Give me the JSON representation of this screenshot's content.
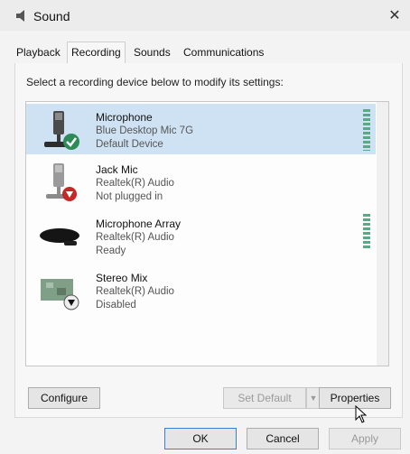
{
  "window": {
    "title": "Sound"
  },
  "tabs": [
    {
      "label": "Playback",
      "active": false
    },
    {
      "label": "Recording",
      "active": true
    },
    {
      "label": "Sounds",
      "active": false
    },
    {
      "label": "Communications",
      "active": false
    }
  ],
  "instruction": "Select a recording device below to modify its settings:",
  "devices": [
    {
      "name": "Microphone",
      "driver": "Blue Desktop Mic 7G",
      "status": "Default Device",
      "selected": true,
      "badge": "default-check"
    },
    {
      "name": "Jack Mic",
      "driver": "Realtek(R) Audio",
      "status": "Not plugged in",
      "selected": false,
      "badge": "unplugged-arrow"
    },
    {
      "name": "Microphone Array",
      "driver": "Realtek(R) Audio",
      "status": "Ready",
      "selected": false,
      "badge": "none"
    },
    {
      "name": "Stereo Mix",
      "driver": "Realtek(R) Audio",
      "status": "Disabled",
      "selected": false,
      "badge": "disabled-arrow"
    }
  ],
  "buttons": {
    "configure": "Configure",
    "set_default": "Set Default",
    "properties": "Properties",
    "ok": "OK",
    "cancel": "Cancel",
    "apply": "Apply"
  },
  "colors": {
    "selection": "#cfe2f4",
    "check_badge": "#2e8b57",
    "unplugged_badge": "#c62828",
    "level_meter": "#5aa986"
  }
}
